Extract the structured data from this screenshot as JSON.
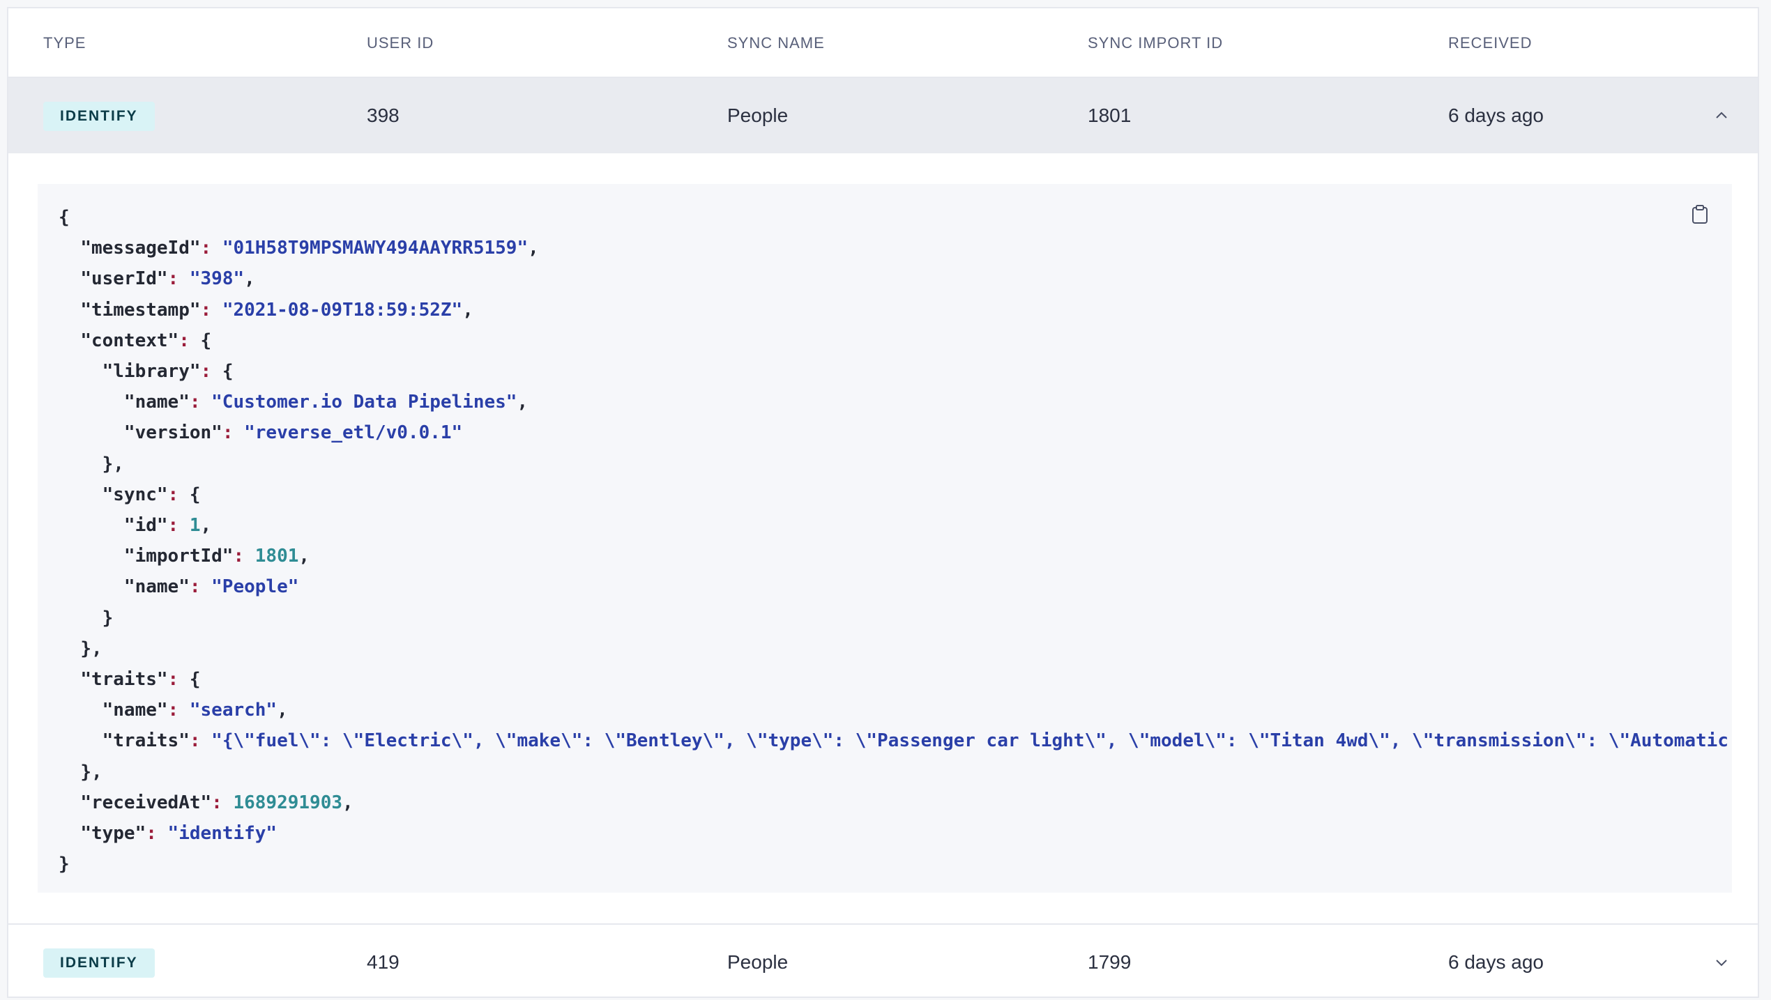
{
  "columns": {
    "type": "TYPE",
    "user_id": "USER ID",
    "sync_name": "SYNC NAME",
    "sync_import_id": "SYNC IMPORT ID",
    "received": "RECEIVED"
  },
  "rows": [
    {
      "type": "IDENTIFY",
      "user_id": "398",
      "sync_name": "People",
      "sync_import_id": "1801",
      "received": "6 days ago",
      "expanded": true,
      "toggle_icon": "chevron-up-icon"
    },
    {
      "type": "IDENTIFY",
      "user_id": "419",
      "sync_name": "People",
      "sync_import_id": "1799",
      "received": "6 days ago",
      "expanded": false,
      "toggle_icon": "chevron-down-icon"
    }
  ],
  "payload": {
    "copy_icon": "clipboard-icon",
    "lines": [
      [
        [
          "b",
          "{"
        ]
      ],
      [
        [
          "i",
          "  "
        ],
        [
          "k",
          "\"messageId\""
        ],
        [
          "p",
          ": "
        ],
        [
          "s",
          "\"01H58T9MPSMAWY494AAYRR5159\""
        ],
        [
          "b",
          ","
        ]
      ],
      [
        [
          "i",
          "  "
        ],
        [
          "k",
          "\"userId\""
        ],
        [
          "p",
          ": "
        ],
        [
          "s",
          "\"398\""
        ],
        [
          "b",
          ","
        ]
      ],
      [
        [
          "i",
          "  "
        ],
        [
          "k",
          "\"timestamp\""
        ],
        [
          "p",
          ": "
        ],
        [
          "s",
          "\"2021-08-09T18:59:52Z\""
        ],
        [
          "b",
          ","
        ]
      ],
      [
        [
          "i",
          "  "
        ],
        [
          "k",
          "\"context\""
        ],
        [
          "p",
          ": "
        ],
        [
          "b",
          "{"
        ]
      ],
      [
        [
          "i",
          "    "
        ],
        [
          "k",
          "\"library\""
        ],
        [
          "p",
          ": "
        ],
        [
          "b",
          "{"
        ]
      ],
      [
        [
          "i",
          "      "
        ],
        [
          "k",
          "\"name\""
        ],
        [
          "p",
          ": "
        ],
        [
          "s",
          "\"Customer.io Data Pipelines\""
        ],
        [
          "b",
          ","
        ]
      ],
      [
        [
          "i",
          "      "
        ],
        [
          "k",
          "\"version\""
        ],
        [
          "p",
          ": "
        ],
        [
          "s",
          "\"reverse_etl/v0.0.1\""
        ]
      ],
      [
        [
          "i",
          "    "
        ],
        [
          "b",
          "},"
        ]
      ],
      [
        [
          "i",
          "    "
        ],
        [
          "k",
          "\"sync\""
        ],
        [
          "p",
          ": "
        ],
        [
          "b",
          "{"
        ]
      ],
      [
        [
          "i",
          "      "
        ],
        [
          "k",
          "\"id\""
        ],
        [
          "p",
          ": "
        ],
        [
          "n",
          "1"
        ],
        [
          "b",
          ","
        ]
      ],
      [
        [
          "i",
          "      "
        ],
        [
          "k",
          "\"importId\""
        ],
        [
          "p",
          ": "
        ],
        [
          "n",
          "1801"
        ],
        [
          "b",
          ","
        ]
      ],
      [
        [
          "i",
          "      "
        ],
        [
          "k",
          "\"name\""
        ],
        [
          "p",
          ": "
        ],
        [
          "s",
          "\"People\""
        ]
      ],
      [
        [
          "i",
          "    "
        ],
        [
          "b",
          "}"
        ]
      ],
      [
        [
          "i",
          "  "
        ],
        [
          "b",
          "},"
        ]
      ],
      [
        [
          "i",
          "  "
        ],
        [
          "k",
          "\"traits\""
        ],
        [
          "p",
          ": "
        ],
        [
          "b",
          "{"
        ]
      ],
      [
        [
          "i",
          "    "
        ],
        [
          "k",
          "\"name\""
        ],
        [
          "p",
          ": "
        ],
        [
          "s",
          "\"search\""
        ],
        [
          "b",
          ","
        ]
      ],
      [
        [
          "i",
          "    "
        ],
        [
          "k",
          "\"traits\""
        ],
        [
          "p",
          ": "
        ],
        [
          "s",
          "\"{\\\"fuel\\\": \\\"Electric\\\", \\\"make\\\": \\\"Bentley\\\", \\\"type\\\": \\\"Passenger car light\\\", \\\"model\\\": \\\"Titan 4wd\\\", \\\"transmission\\\": \\\"Automatic"
        ]
      ],
      [
        [
          "i",
          "  "
        ],
        [
          "b",
          "},"
        ]
      ],
      [
        [
          "i",
          "  "
        ],
        [
          "k",
          "\"receivedAt\""
        ],
        [
          "p",
          ": "
        ],
        [
          "n",
          "1689291903"
        ],
        [
          "b",
          ","
        ]
      ],
      [
        [
          "i",
          "  "
        ],
        [
          "k",
          "\"type\""
        ],
        [
          "p",
          ": "
        ],
        [
          "s",
          "\"identify\""
        ]
      ],
      [
        [
          "b",
          "}"
        ]
      ]
    ]
  },
  "colors": {
    "badge_bg": "#d9f3f6",
    "badge_text": "#0b3c48",
    "expanded_row_bg": "#e9ebf0",
    "json_string": "#2a3fa8",
    "json_number": "#2f8c94",
    "json_colon": "#9a1c3a"
  }
}
